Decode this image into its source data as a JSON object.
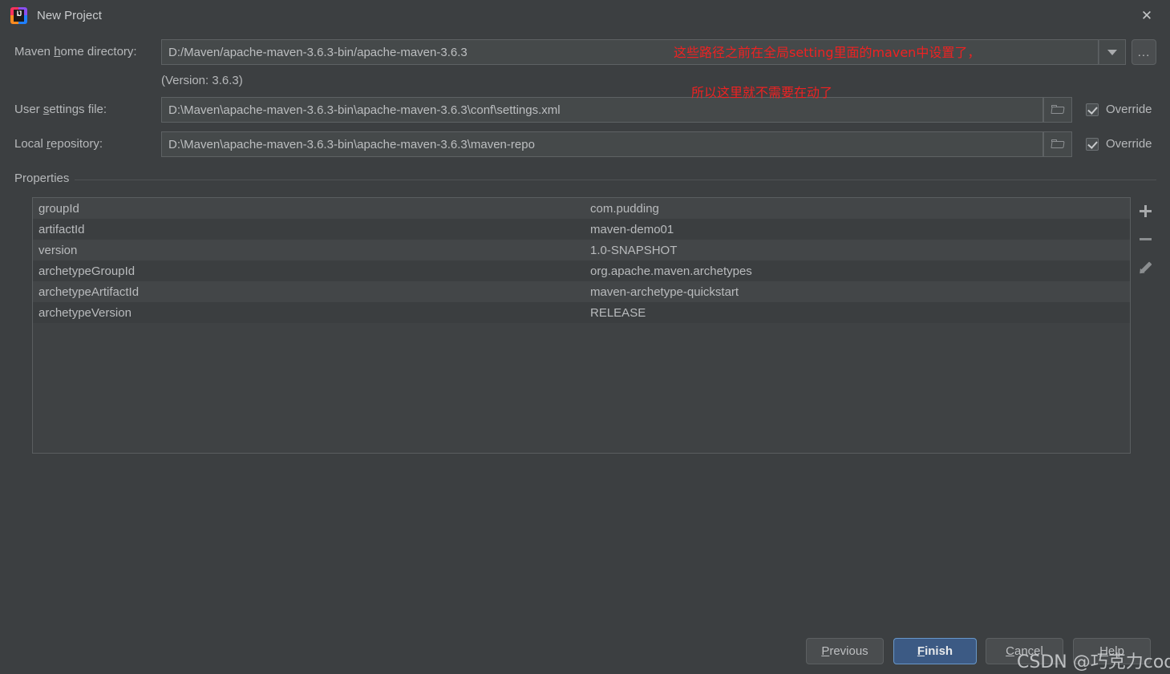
{
  "window": {
    "title": "New Project",
    "icon": "intellij-idea-icon",
    "close_label": "✕"
  },
  "form": {
    "maven_home": {
      "label_pre": "Maven ",
      "label_mnemonic": "h",
      "label_post": "ome directory:",
      "value": "D:/Maven/apache-maven-3.6.3-bin/apache-maven-3.6.3",
      "placeholder": "",
      "browse_label": "...",
      "version_note": "(Version: 3.6.3)"
    },
    "user_settings": {
      "label_pre": "User ",
      "label_mnemonic": "s",
      "label_post": "ettings file:",
      "value": "D:\\Maven\\apache-maven-3.6.3-bin\\apache-maven-3.6.3\\conf\\settings.xml",
      "placeholder": "",
      "override_label": "Override",
      "override_checked": true
    },
    "local_repository": {
      "label_pre": "Local ",
      "label_mnemonic": "r",
      "label_post": "epository:",
      "value": "D:\\Maven\\apache-maven-3.6.3-bin\\apache-maven-3.6.3\\maven-repo",
      "placeholder": "",
      "override_label": "Override",
      "override_checked": true
    }
  },
  "properties": {
    "group_title": "Properties",
    "rows": [
      {
        "key": "groupId",
        "value": "com.pudding"
      },
      {
        "key": "artifactId",
        "value": "maven-demo01"
      },
      {
        "key": "version",
        "value": "1.0-SNAPSHOT"
      },
      {
        "key": "archetypeGroupId",
        "value": "org.apache.maven.archetypes"
      },
      {
        "key": "archetypeArtifactId",
        "value": "maven-archetype-quickstart"
      },
      {
        "key": "archetypeVersion",
        "value": "RELEASE"
      }
    ],
    "toolbar": {
      "add": "add-property",
      "remove": "remove-property",
      "edit": "edit-property"
    }
  },
  "buttons": {
    "previous": {
      "pre": "",
      "mnemonic": "P",
      "post": "revious"
    },
    "finish": {
      "pre": "",
      "mnemonic": "F",
      "post": "inish"
    },
    "cancel": {
      "pre": "",
      "mnemonic": "C",
      "post": "ancel"
    },
    "help": {
      "pre": "",
      "mnemonic": "H",
      "post": "elp"
    }
  },
  "annotation": {
    "line1": "这些路径之前在全局setting里面的maven中设置了，",
    "line2": "所以这里就不需要在动了",
    "color": "#ee2222"
  },
  "watermark": {
    "text": "CSDN @巧克力code"
  },
  "colors": {
    "dialog_bg": "#3c3f41",
    "field_bg": "#45494a",
    "row_odd": "#434648",
    "row_even": "#3b3e40",
    "primary_button": "#3c5a84",
    "accent_border": "#6897c8"
  }
}
